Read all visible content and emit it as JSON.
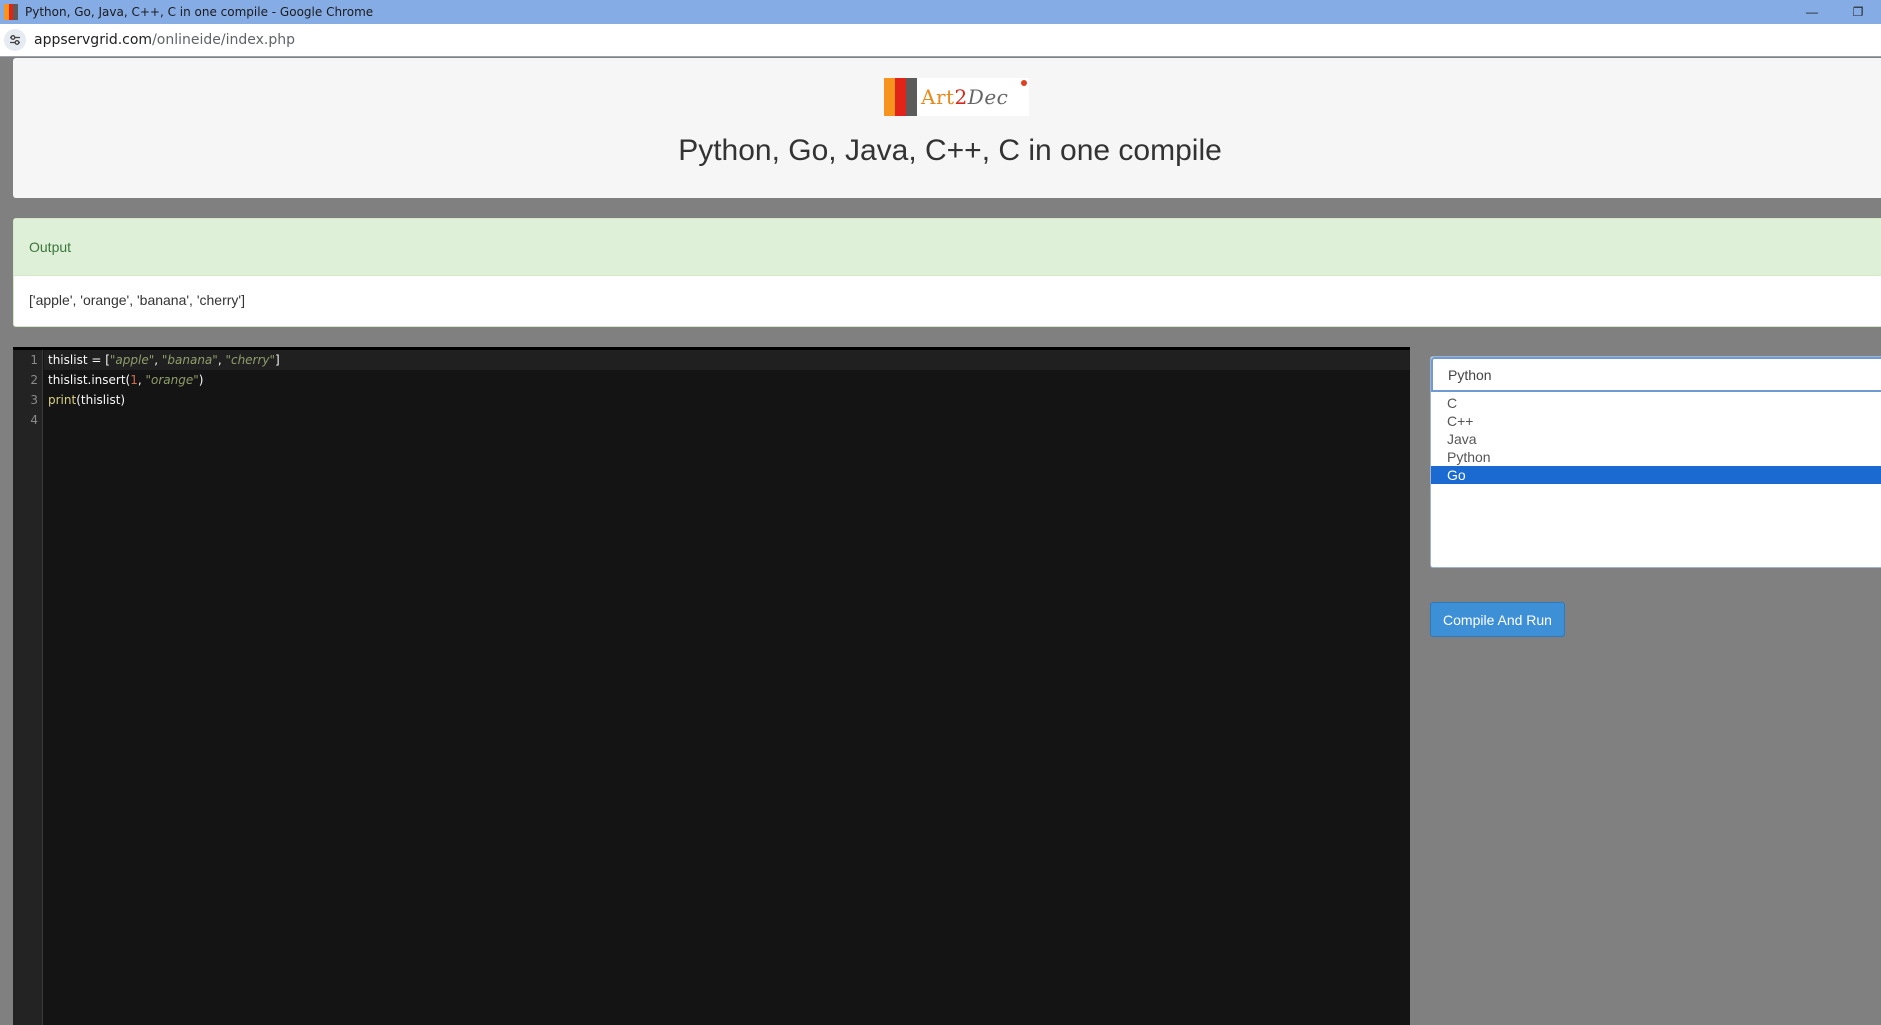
{
  "browser": {
    "window_title": "Python, Go, Java, C++, C in one compile - Google Chrome",
    "url_host": "appservgrid.com",
    "url_path": "/onlineide/index.php",
    "minimize_glyph": "—",
    "restore_glyph": "❐"
  },
  "header": {
    "logo": {
      "text_a": "Art",
      "text_2": "2",
      "text_dec": "Dec",
      "bar_colors": [
        "#f7941d",
        "#e2231a",
        "#5b5b5b"
      ]
    },
    "title": "Python, Go, Java, C++, C in one compile"
  },
  "output": {
    "heading": "Output",
    "text": "['apple', 'orange', 'banana', 'cherry']"
  },
  "editor": {
    "line_numbers": [
      "1",
      "2",
      "3",
      "4"
    ],
    "lines": [
      {
        "segments": [
          {
            "text": "thislist = [",
            "kind": "plain"
          },
          {
            "text": "\"apple\"",
            "kind": "str"
          },
          {
            "text": ", ",
            "kind": "plain"
          },
          {
            "text": "\"banana\"",
            "kind": "str"
          },
          {
            "text": ", ",
            "kind": "plain"
          },
          {
            "text": "\"cherry\"",
            "kind": "str"
          },
          {
            "text": "]",
            "kind": "plain"
          }
        ]
      },
      {
        "segments": [
          {
            "text": "thislist.insert(",
            "kind": "plain"
          },
          {
            "text": "1",
            "kind": "num"
          },
          {
            "text": ", ",
            "kind": "plain"
          },
          {
            "text": "\"orange\"",
            "kind": "str"
          },
          {
            "text": ")",
            "kind": "plain"
          }
        ]
      },
      {
        "segments": [
          {
            "text": "print",
            "kind": "fn"
          },
          {
            "text": "(thislist)",
            "kind": "plain"
          }
        ]
      },
      {
        "segments": []
      }
    ],
    "active_line": 1
  },
  "language_select": {
    "current": "Python",
    "options": [
      "C",
      "C++",
      "Java",
      "Python",
      "Go"
    ],
    "highlighted": "Go"
  },
  "compile_button": {
    "label": "Compile And Run",
    "color": "#3d8fd6"
  }
}
